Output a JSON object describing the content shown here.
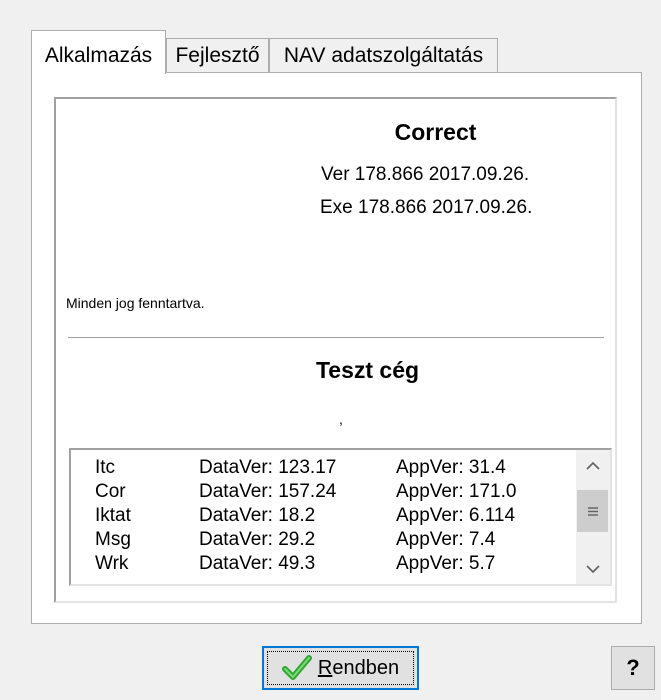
{
  "tabs": [
    {
      "label": "Alkalmazás"
    },
    {
      "label": "Fejlesztő"
    },
    {
      "label": "NAV adatszolgáltatás"
    }
  ],
  "app": {
    "name": "Correct",
    "ver_line": "Ver 178.866 2017.09.26.",
    "exe_line": "Exe 178.866 2017.09.26.",
    "rights": "Minden jog fenntartva."
  },
  "company": {
    "name": "Teszt cég",
    "sub": ","
  },
  "modules": [
    {
      "name": "Itc",
      "data_ver": "DataVer: 123.17",
      "app_ver": "AppVer: 31.4"
    },
    {
      "name": "Cor",
      "data_ver": "DataVer: 157.24",
      "app_ver": "AppVer: 171.0"
    },
    {
      "name": "Iktat",
      "data_ver": "DataVer: 18.2",
      "app_ver": "AppVer: 6.114"
    },
    {
      "name": "Msg",
      "data_ver": "DataVer: 29.2",
      "app_ver": "AppVer: 7.4"
    },
    {
      "name": "Wrk",
      "data_ver": "DataVer: 49.3",
      "app_ver": "AppVer: 5.7"
    }
  ],
  "buttons": {
    "ok_label": "Rendben",
    "help_label": "?"
  },
  "colors": {
    "focus_border": "#0078d7",
    "check_green": "#2ea82e"
  },
  "icons": {
    "ok": "checkmark-icon",
    "scroll_up": "chevron-up-icon",
    "scroll_down": "chevron-down-icon",
    "thumb": "grip-icon"
  }
}
